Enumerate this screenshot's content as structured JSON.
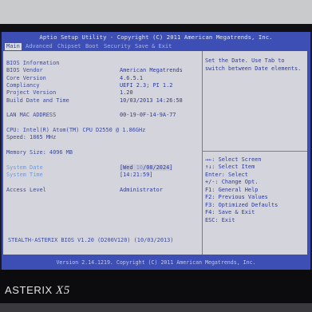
{
  "title": "Aptio Setup Utility - Copyright (C) 2011 American Megatrends, Inc.",
  "tabs": [
    "Main",
    "Advanced",
    "Chipset",
    "Boot",
    "Security",
    "Save & Exit"
  ],
  "info": {
    "heading": "BIOS Information",
    "rows": [
      {
        "label": "BIOS Vendor",
        "value": "American Megatrends"
      },
      {
        "label": "Core Version",
        "value": "4.6.5.1"
      },
      {
        "label": "Compliancy",
        "value": "UEFI 2.3; PI 1.2"
      },
      {
        "label": "Project Version",
        "value": "1.20"
      },
      {
        "label": "Build Date and Time",
        "value": "10/03/2013 14:26:58"
      }
    ],
    "lan": {
      "label": "LAN MAC ADDRESS",
      "value": "00-19-0F-14-9A-77"
    },
    "cpu": "CPU: Intel(R) Atom(TM) CPU D2550   @ 1.86GHz",
    "speed": "Speed: 1865 MHz",
    "memory": "Memory Size: 4096 MB",
    "system_date": {
      "label": "System Date",
      "day": "[Wed ",
      "cursor": "10",
      "rest": "/08/2024]"
    },
    "system_time": {
      "label": "System Time",
      "value": "[14:21:59]"
    },
    "access": {
      "label": "Access Level",
      "value": "Administrator"
    },
    "footer_id": "STEALTH-ASTERIX BIOS V1.20 (D200V120) (10/03/2013)"
  },
  "help": {
    "description": [
      "Set the Date. Use Tab to",
      "switch between Date elements."
    ],
    "keys": [
      "→←: Select Screen",
      "↑↓: Select Item",
      "Enter: Select",
      "+/-: Change Opt.",
      "F1: General Help",
      "F2: Previous Values",
      "F3: Optimized Defaults",
      "F4: Save & Exit",
      "ESC: Exit"
    ]
  },
  "version_bar": "Version 2.14.1219. Copyright (C) 2011 American Megatrends, Inc.",
  "brand": {
    "name": "ASTERIX",
    "model": "X5"
  },
  "colors": {
    "bios_blue": "#3d4fb4",
    "panel": "#d4d5dc",
    "highlight": "#6d9ae0"
  }
}
